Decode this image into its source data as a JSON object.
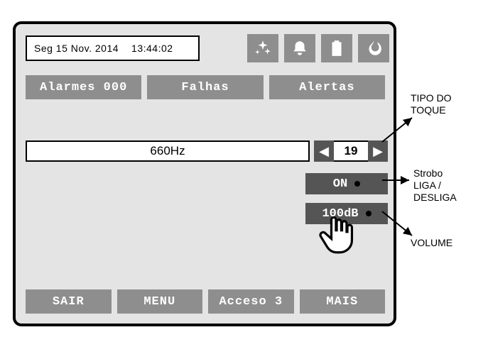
{
  "datetime": {
    "date": "Seg 15 Nov. 2014",
    "time": "13:44:02"
  },
  "icons": [
    "sparkle-icon",
    "bell-icon",
    "battery-icon",
    "flame-icon"
  ],
  "tabs": {
    "alarms": "Alarmes 000",
    "faults": "Falhas",
    "alerts": "Alertas"
  },
  "tone": {
    "freq": "660Hz",
    "index": "19"
  },
  "strobe": {
    "label": "ON"
  },
  "volume": {
    "label": "100dB"
  },
  "bottom": {
    "exit": "SAIR",
    "menu": "MENU",
    "access": "Acceso 3",
    "more": "MAIS"
  },
  "annotations": {
    "tone_type": "TIPO DO\nTOQUE",
    "strobe": "Strobo\nLIGA /\nDESLIGA",
    "volume": "VOLUME"
  }
}
